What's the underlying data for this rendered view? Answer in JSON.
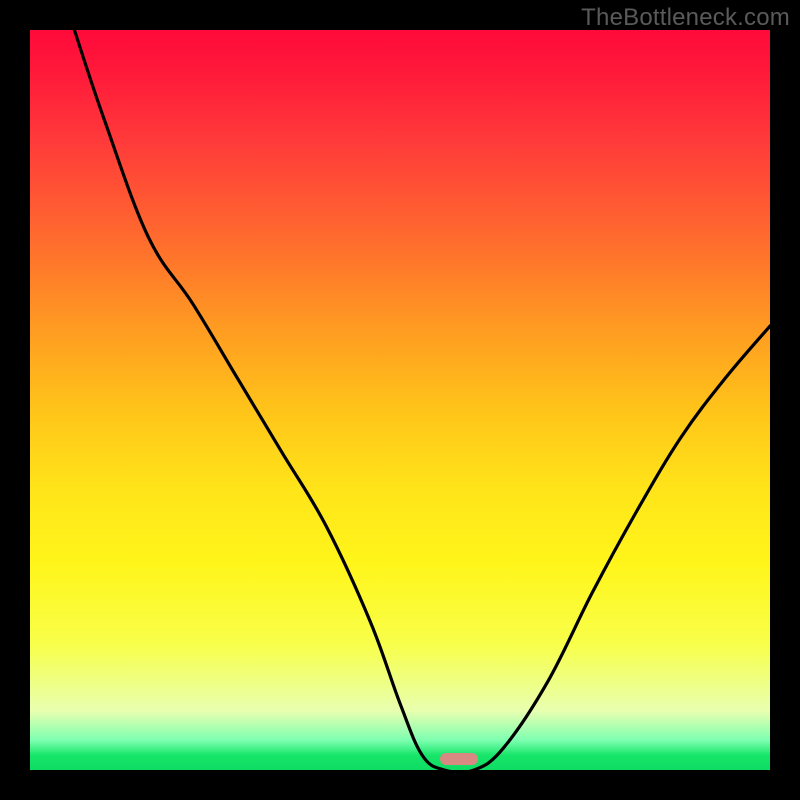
{
  "watermark": "TheBottleneck.com",
  "chart_data": {
    "type": "line",
    "title": "",
    "xlabel": "",
    "ylabel": "",
    "xlim": [
      0,
      100
    ],
    "ylim": [
      0,
      100
    ],
    "grid": false,
    "legend": false,
    "background": "red-yellow-green vertical gradient (red=high bottleneck at top, green=low at bottom)",
    "series": [
      {
        "name": "bottleneck-curve",
        "x": [
          6,
          10,
          16,
          22,
          28,
          34,
          40,
          46,
          50,
          53,
          56,
          60,
          64,
          70,
          76,
          82,
          88,
          94,
          100
        ],
        "y": [
          100,
          88,
          72,
          63,
          53,
          43,
          33,
          20,
          9,
          2,
          0,
          0,
          3,
          12,
          24,
          35,
          45,
          53,
          60
        ]
      }
    ],
    "optimum_marker": {
      "x": 58,
      "y": 1.5,
      "color": "#d88a82"
    }
  }
}
